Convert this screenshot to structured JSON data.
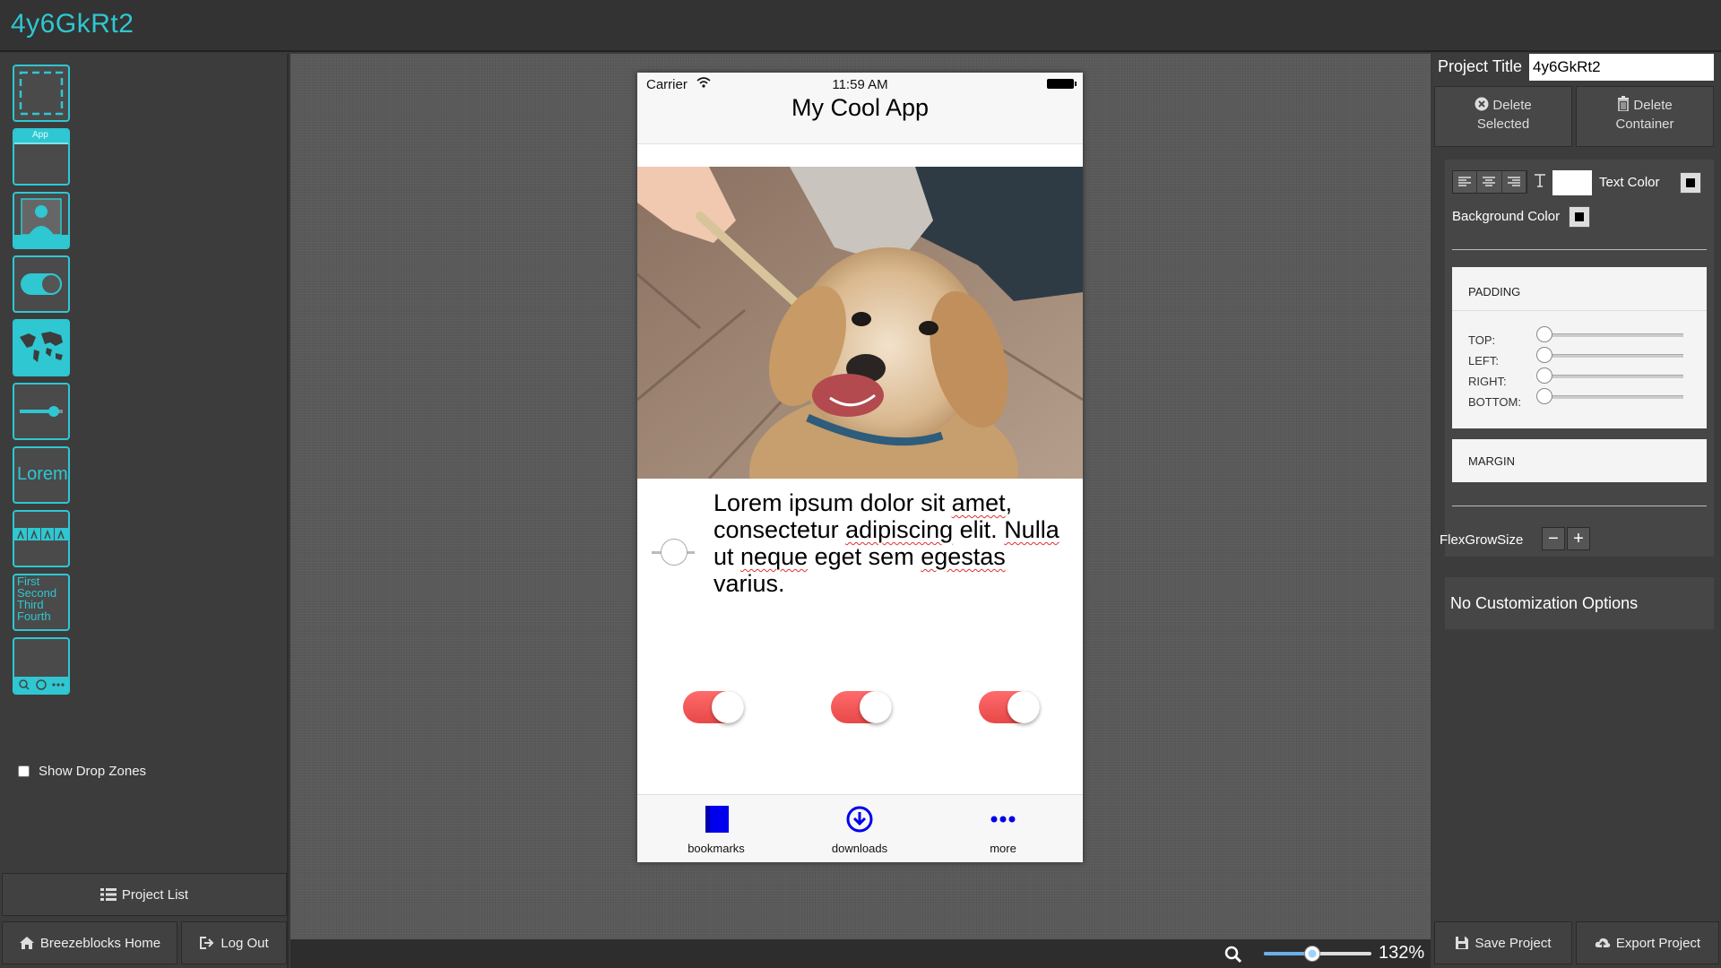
{
  "app": {
    "title": "4y6GkRt2"
  },
  "sidebar": {
    "tools": [
      {
        "icon": "container-icon"
      },
      {
        "icon": "app-header-icon",
        "label": "App"
      },
      {
        "icon": "image-icon"
      },
      {
        "icon": "toggle-icon"
      },
      {
        "icon": "map-icon"
      },
      {
        "icon": "slider-icon"
      },
      {
        "icon": "text-icon",
        "label": "Lorem"
      },
      {
        "icon": "grid-icon"
      },
      {
        "icon": "list-icon",
        "lines": [
          "First",
          "Second",
          "Third",
          "Fourth"
        ]
      },
      {
        "icon": "tabbar-icon"
      }
    ],
    "show_drop_zones": "Show Drop Zones",
    "project_list": "Project List",
    "home": "Breezeblocks Home",
    "logout": "Log Out"
  },
  "canvas": {
    "zoom": {
      "value": "132%",
      "level": 0.45
    }
  },
  "phone": {
    "status": {
      "carrier": "Carrier",
      "time": "11:59 AM"
    },
    "nav_title": "My Cool App",
    "text_words": [
      {
        "t": "Lorem ipsum dolor sit ",
        "sp": false
      },
      {
        "t": "amet",
        "sp": true
      },
      {
        "t": ", consectetur ",
        "sp": false
      },
      {
        "t": "adipiscing",
        "sp": true
      },
      {
        "t": " elit. ",
        "sp": false
      },
      {
        "t": "Nulla",
        "sp": true
      },
      {
        "t": " ut ",
        "sp": false
      },
      {
        "t": "neque",
        "sp": true
      },
      {
        "t": " eget sem ",
        "sp": false
      },
      {
        "t": "egestas",
        "sp": true
      },
      {
        "t": " varius.",
        "sp": false
      }
    ],
    "toggles": [
      true,
      true,
      true
    ],
    "tabs": [
      {
        "icon": "book-icon",
        "label": "bookmarks"
      },
      {
        "icon": "download-icon",
        "label": "downloads"
      },
      {
        "icon": "more-icon",
        "label": "more"
      }
    ],
    "accent": "#ff5a5a",
    "tab_color": "#0000ee"
  },
  "right": {
    "project_title_label": "Project Title",
    "project_title_value": "4y6GkRt2",
    "delete_selected": [
      "Delete",
      "Selected"
    ],
    "delete_container": [
      "Delete",
      "Container"
    ],
    "text_color_label": "Text Color",
    "background_color_label": "Background Color",
    "padding_title": "PADDING",
    "padding": [
      {
        "label": "TOP:",
        "value": 0
      },
      {
        "label": "LEFT:",
        "value": 0
      },
      {
        "label": "RIGHT:",
        "value": 0
      },
      {
        "label": "BOTTOM:",
        "value": 0
      }
    ],
    "margin_title": "MARGIN",
    "flex_label": "FlexGrowSize",
    "no_custom": "No Customization Options",
    "save": "Save Project",
    "export": "Export Project"
  }
}
